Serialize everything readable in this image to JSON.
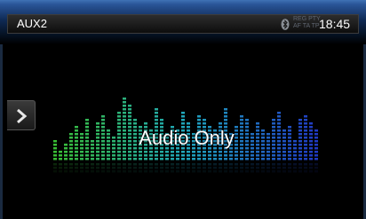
{
  "header": {
    "source": "AUX2",
    "indicators_top": "REG PTY",
    "indicators_bottom": "AF TA TP",
    "time": "18:45"
  },
  "icons": {
    "bluetooth": "bluetooth-icon",
    "side_button": "chevron-right-icon"
  },
  "main": {
    "status_text": "Audio Only"
  },
  "colors": {
    "accent_blue": "#2a5598",
    "eq_green": "#3fd13a",
    "eq_cyan": "#22b7d0",
    "eq_blue": "#2340d8"
  }
}
